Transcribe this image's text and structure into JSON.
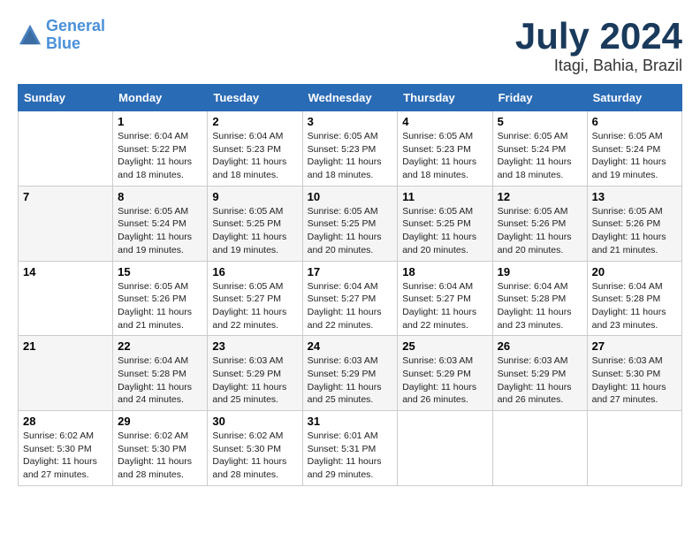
{
  "logo": {
    "line1": "General",
    "line2": "Blue"
  },
  "title": "July 2024",
  "location": "Itagi, Bahia, Brazil",
  "days_of_week": [
    "Sunday",
    "Monday",
    "Tuesday",
    "Wednesday",
    "Thursday",
    "Friday",
    "Saturday"
  ],
  "weeks": [
    [
      {
        "day": "",
        "info": ""
      },
      {
        "day": "1",
        "info": "Sunrise: 6:04 AM\nSunset: 5:22 PM\nDaylight: 11 hours\nand 18 minutes."
      },
      {
        "day": "2",
        "info": "Sunrise: 6:04 AM\nSunset: 5:23 PM\nDaylight: 11 hours\nand 18 minutes."
      },
      {
        "day": "3",
        "info": "Sunrise: 6:05 AM\nSunset: 5:23 PM\nDaylight: 11 hours\nand 18 minutes."
      },
      {
        "day": "4",
        "info": "Sunrise: 6:05 AM\nSunset: 5:23 PM\nDaylight: 11 hours\nand 18 minutes."
      },
      {
        "day": "5",
        "info": "Sunrise: 6:05 AM\nSunset: 5:24 PM\nDaylight: 11 hours\nand 18 minutes."
      },
      {
        "day": "6",
        "info": "Sunrise: 6:05 AM\nSunset: 5:24 PM\nDaylight: 11 hours\nand 19 minutes."
      }
    ],
    [
      {
        "day": "7",
        "info": ""
      },
      {
        "day": "8",
        "info": "Sunrise: 6:05 AM\nSunset: 5:24 PM\nDaylight: 11 hours\nand 19 minutes."
      },
      {
        "day": "9",
        "info": "Sunrise: 6:05 AM\nSunset: 5:25 PM\nDaylight: 11 hours\nand 19 minutes."
      },
      {
        "day": "10",
        "info": "Sunrise: 6:05 AM\nSunset: 5:25 PM\nDaylight: 11 hours\nand 20 minutes."
      },
      {
        "day": "11",
        "info": "Sunrise: 6:05 AM\nSunset: 5:25 PM\nDaylight: 11 hours\nand 20 minutes."
      },
      {
        "day": "12",
        "info": "Sunrise: 6:05 AM\nSunset: 5:26 PM\nDaylight: 11 hours\nand 20 minutes."
      },
      {
        "day": "13",
        "info": "Sunrise: 6:05 AM\nSunset: 5:26 PM\nDaylight: 11 hours\nand 21 minutes."
      }
    ],
    [
      {
        "day": "14",
        "info": ""
      },
      {
        "day": "15",
        "info": "Sunrise: 6:05 AM\nSunset: 5:26 PM\nDaylight: 11 hours\nand 21 minutes."
      },
      {
        "day": "16",
        "info": "Sunrise: 6:05 AM\nSunset: 5:27 PM\nDaylight: 11 hours\nand 22 minutes."
      },
      {
        "day": "17",
        "info": "Sunrise: 6:04 AM\nSunset: 5:27 PM\nDaylight: 11 hours\nand 22 minutes."
      },
      {
        "day": "18",
        "info": "Sunrise: 6:04 AM\nSunset: 5:27 PM\nDaylight: 11 hours\nand 22 minutes."
      },
      {
        "day": "19",
        "info": "Sunrise: 6:04 AM\nSunset: 5:28 PM\nDaylight: 11 hours\nand 23 minutes."
      },
      {
        "day": "20",
        "info": "Sunrise: 6:04 AM\nSunset: 5:28 PM\nDaylight: 11 hours\nand 23 minutes."
      }
    ],
    [
      {
        "day": "21",
        "info": ""
      },
      {
        "day": "22",
        "info": "Sunrise: 6:04 AM\nSunset: 5:28 PM\nDaylight: 11 hours\nand 24 minutes."
      },
      {
        "day": "23",
        "info": "Sunrise: 6:03 AM\nSunset: 5:29 PM\nDaylight: 11 hours\nand 25 minutes."
      },
      {
        "day": "24",
        "info": "Sunrise: 6:03 AM\nSunset: 5:29 PM\nDaylight: 11 hours\nand 25 minutes."
      },
      {
        "day": "25",
        "info": "Sunrise: 6:03 AM\nSunset: 5:29 PM\nDaylight: 11 hours\nand 26 minutes."
      },
      {
        "day": "26",
        "info": "Sunrise: 6:03 AM\nSunset: 5:29 PM\nDaylight: 11 hours\nand 26 minutes."
      },
      {
        "day": "27",
        "info": "Sunrise: 6:03 AM\nSunset: 5:30 PM\nDaylight: 11 hours\nand 27 minutes."
      }
    ],
    [
      {
        "day": "28",
        "info": "Sunrise: 6:02 AM\nSunset: 5:30 PM\nDaylight: 11 hours\nand 27 minutes."
      },
      {
        "day": "29",
        "info": "Sunrise: 6:02 AM\nSunset: 5:30 PM\nDaylight: 11 hours\nand 28 minutes."
      },
      {
        "day": "30",
        "info": "Sunrise: 6:02 AM\nSunset: 5:30 PM\nDaylight: 11 hours\nand 28 minutes."
      },
      {
        "day": "31",
        "info": "Sunrise: 6:01 AM\nSunset: 5:31 PM\nDaylight: 11 hours\nand 29 minutes."
      },
      {
        "day": "",
        "info": ""
      },
      {
        "day": "",
        "info": ""
      },
      {
        "day": "",
        "info": ""
      }
    ]
  ]
}
